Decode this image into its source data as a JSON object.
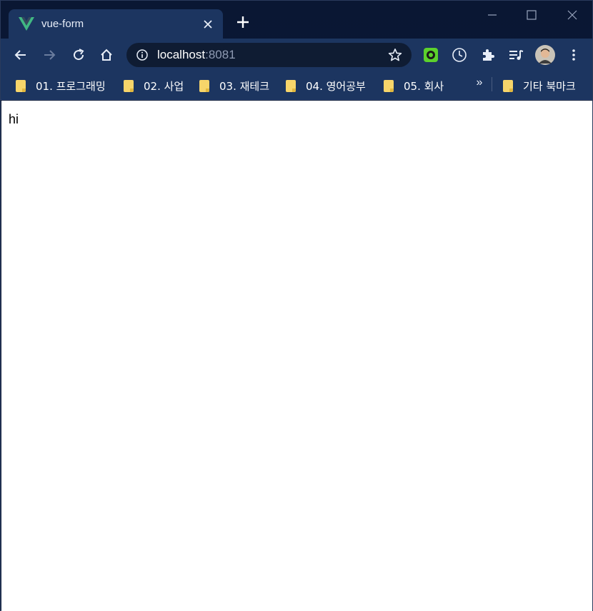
{
  "tab": {
    "title": "vue-form"
  },
  "window_controls": {
    "minimize": "minimize",
    "maximize": "maximize",
    "close": "close"
  },
  "toolbar": {
    "url_host": "localhost",
    "url_port": ":8081"
  },
  "bookmarks": [
    {
      "label": "01. 프로그래밍"
    },
    {
      "label": "02. 사업"
    },
    {
      "label": "03. 재테크"
    },
    {
      "label": "04. 영어공부"
    },
    {
      "label": "05. 회사"
    }
  ],
  "other_bookmarks": {
    "label": "기타 북마크",
    "overflow": "»"
  },
  "page": {
    "text": "hi"
  },
  "colors": {
    "frame": "#0a1733",
    "toolbar": "#1c3560",
    "omnibox": "#0f1c33",
    "vue_green": "#41b883",
    "vue_dark": "#35495e",
    "folder": "#f7d56a"
  }
}
